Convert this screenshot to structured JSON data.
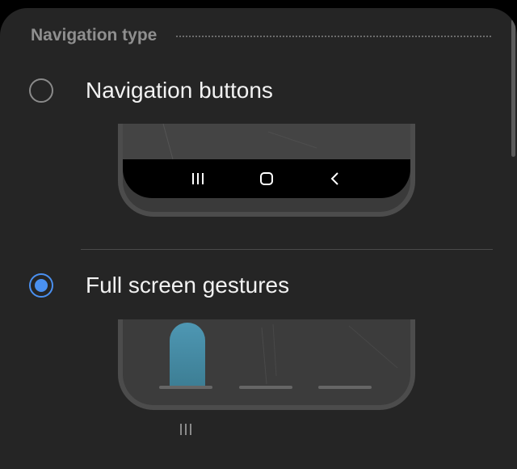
{
  "section": {
    "title": "Navigation type"
  },
  "options": [
    {
      "label": "Navigation buttons",
      "selected": false
    },
    {
      "label": "Full screen gestures",
      "selected": true
    }
  ],
  "preview_buttons": {
    "icons": [
      "recent-apps-icon",
      "home-icon",
      "back-icon"
    ]
  },
  "preview_gestures": {
    "bars": 3
  },
  "colors": {
    "accent": "#4a90f0",
    "background": "#252525",
    "text_primary": "#f2f2f2",
    "text_secondary": "#8f8f8f"
  }
}
